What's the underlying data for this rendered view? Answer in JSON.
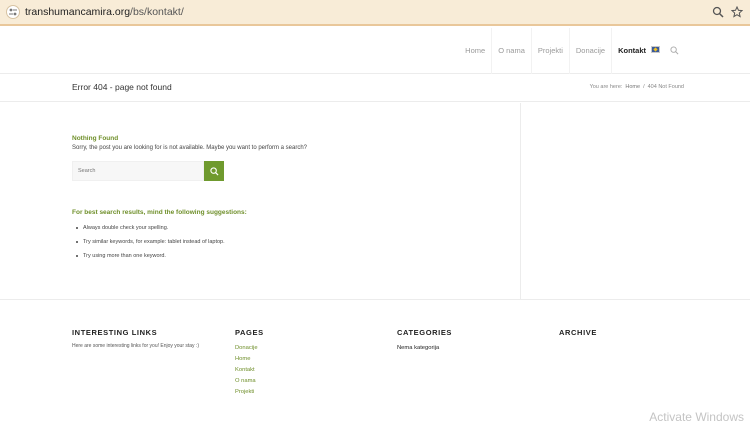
{
  "browser": {
    "url_domain": "transhumancamira.org",
    "url_path": "/bs/kontakt/",
    "icons": [
      "site-info-icon",
      "zoom-icon",
      "star-icon"
    ]
  },
  "nav": {
    "items": [
      {
        "label": "Home",
        "active": false
      },
      {
        "label": "O nama",
        "active": false
      },
      {
        "label": "Projekti",
        "active": false
      },
      {
        "label": "Donacije",
        "active": false
      },
      {
        "label": "Kontakt",
        "active": true
      }
    ]
  },
  "title_bar": {
    "title": "Error 404 - page not found",
    "breadcrumb_prefix": "You are here:",
    "breadcrumb_home": "Home",
    "breadcrumb_sep": "/",
    "breadcrumb_current": "404 Not Found"
  },
  "content": {
    "nothing_found": "Nothing Found",
    "sorry_text": "Sorry, the post you are looking for is not available. Maybe you want to perform a search?",
    "search_placeholder": "Search",
    "tips_heading": "For best search results, mind the following suggestions:",
    "tips": [
      "Always double check your spelling.",
      "Try similar keywords, for example: tablet instead of laptop.",
      "Try using more than one keyword."
    ]
  },
  "footer": {
    "interesting": {
      "heading": "INTERESTING LINKS",
      "text": "Here are some interesting links for you! Enjoy your stay :)"
    },
    "pages": {
      "heading": "PAGES",
      "links": [
        "Donacije",
        "Home",
        "Kontakt",
        "O nama",
        "Projekti"
      ]
    },
    "categories": {
      "heading": "CATEGORIES",
      "items": [
        "Nema kategorija"
      ]
    },
    "archive": {
      "heading": "ARCHIVE"
    }
  },
  "watermark": "Activate Windows",
  "colors": {
    "accent_green": "#6f8f2a",
    "address_bar": "#f8ecd7"
  }
}
